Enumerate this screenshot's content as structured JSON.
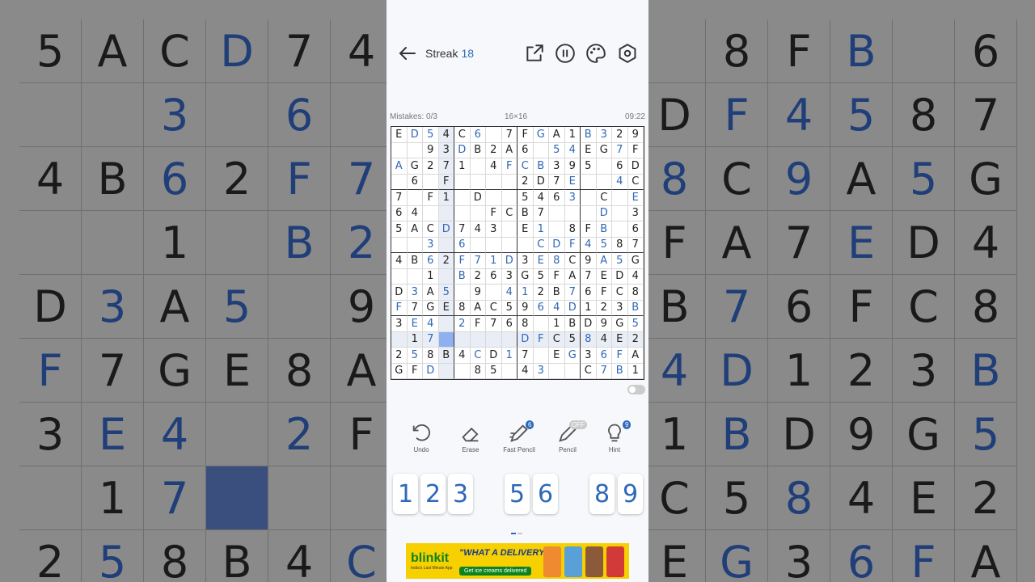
{
  "topbar": {
    "streak_label": "Streak",
    "streak_value": "18"
  },
  "info": {
    "mistakes": "Mistakes: 0/3",
    "size": "16×16",
    "time": "09:22"
  },
  "board": {
    "rows": [
      [
        "E",
        "D",
        "5",
        "4",
        "C",
        "6",
        "",
        "7",
        "F",
        "G",
        "A",
        "1",
        "B",
        "3",
        "2",
        "9"
      ],
      [
        "",
        "",
        "9",
        "3",
        "D",
        "B",
        "2",
        "A",
        "6",
        "",
        "5",
        "4",
        "E",
        "G",
        "7",
        "F"
      ],
      [
        "A",
        "G",
        "2",
        "7",
        "1",
        "",
        "4",
        "F",
        "C",
        "B",
        "3",
        "9",
        "5",
        "",
        "6",
        "D"
      ],
      [
        "",
        "6",
        "",
        "F",
        "",
        "",
        "",
        "",
        "2",
        "D",
        "7",
        "E",
        "",
        "",
        "4",
        "C"
      ],
      [
        "7",
        "",
        "F",
        "1",
        "",
        "D",
        "",
        "",
        "5",
        "4",
        "6",
        "3",
        "",
        "C",
        "",
        "E"
      ],
      [
        "6",
        "4",
        "",
        "",
        "",
        "",
        "F",
        "C",
        "B",
        "7",
        "",
        "",
        "",
        "D",
        "",
        "3"
      ],
      [
        "5",
        "A",
        "C",
        "D",
        "7",
        "4",
        "3",
        "",
        "E",
        "1",
        "",
        "8",
        "F",
        "B",
        "",
        "6"
      ],
      [
        "",
        "",
        "3",
        "",
        "6",
        "",
        "",
        "",
        "",
        "C",
        "D",
        "F",
        "4",
        "5",
        "8",
        "7"
      ],
      [
        "4",
        "B",
        "6",
        "2",
        "F",
        "7",
        "1",
        "D",
        "3",
        "E",
        "8",
        "C",
        "9",
        "A",
        "5",
        "G"
      ],
      [
        "",
        "",
        "1",
        "",
        "B",
        "2",
        "6",
        "3",
        "G",
        "5",
        "F",
        "A",
        "7",
        "E",
        "D",
        "4"
      ],
      [
        "D",
        "3",
        "A",
        "5",
        "",
        "9",
        "",
        "4",
        "1",
        "2",
        "B",
        "7",
        "6",
        "F",
        "C",
        "8"
      ],
      [
        "F",
        "7",
        "G",
        "E",
        "8",
        "A",
        "C",
        "5",
        "9",
        "6",
        "4",
        "D",
        "1",
        "2",
        "3",
        "B"
      ],
      [
        "3",
        "E",
        "4",
        "",
        "2",
        "F",
        "7",
        "6",
        "8",
        "",
        "1",
        "B",
        "D",
        "9",
        "G",
        "5"
      ],
      [
        "",
        "1",
        "7",
        "",
        "",
        "",
        "",
        "",
        "D",
        "F",
        "C",
        "5",
        "8",
        "4",
        "E",
        "2"
      ],
      [
        "2",
        "5",
        "8",
        "B",
        "4",
        "C",
        "D",
        "1",
        "7",
        "",
        "E",
        "G",
        "3",
        "6",
        "F",
        "A"
      ],
      [
        "G",
        "F",
        "D",
        "",
        "",
        "8",
        "5",
        "",
        "4",
        "3",
        "",
        "",
        "C",
        "7",
        "B",
        "1"
      ]
    ],
    "blue": [
      [
        1,
        2,
        5,
        9,
        12,
        13
      ],
      [
        4,
        10,
        11,
        14
      ],
      [
        0,
        7,
        8,
        9
      ],
      [
        11,
        14
      ],
      [
        11,
        15
      ],
      [
        13
      ],
      [
        3,
        7,
        9,
        13
      ],
      [
        2,
        4,
        9,
        10,
        11,
        12,
        13
      ],
      [
        2,
        4,
        5,
        6,
        7,
        9,
        10,
        13,
        14
      ],
      [
        4
      ],
      [
        1,
        3,
        7,
        8,
        11
      ],
      [
        0,
        9,
        10,
        11,
        15
      ],
      [
        1,
        2,
        4,
        15
      ],
      [
        2,
        8,
        9,
        12
      ],
      [
        1,
        5,
        7,
        11,
        13,
        14
      ],
      [
        2,
        9,
        13,
        14
      ]
    ],
    "selected": [
      13,
      3
    ]
  },
  "tools": {
    "undo": "Undo",
    "erase": "Erase",
    "fast_pencil": "Fast Pencil",
    "fast_pencil_badge": "6",
    "pencil": "Pencil",
    "pencil_badge": "OFF",
    "hint": "Hint",
    "hint_badge": "9"
  },
  "numpad": [
    {
      "digit": "1"
    },
    {
      "digit": "2"
    },
    {
      "digit": "3"
    },
    {
      "digit": "5"
    },
    {
      "digit": "6"
    },
    {
      "digit": "8"
    },
    {
      "digit": "9"
    }
  ],
  "ad": {
    "brand": "blinkit",
    "tagline": "India's Last Minute App",
    "headline": "\"WHAT A DELIVERY!\"",
    "cta": "Get ice creams delivered"
  },
  "background": {
    "left_cells": [
      [
        "5",
        "A",
        "C",
        "D",
        "7",
        "4"
      ],
      [
        "",
        "",
        "3",
        "",
        "6",
        ""
      ],
      [
        "4",
        "B",
        "6",
        "2",
        "F",
        "7"
      ],
      [
        "",
        "",
        "1",
        "",
        "B",
        "2"
      ],
      [
        "D",
        "3",
        "A",
        "5",
        "",
        "9"
      ],
      [
        "F",
        "7",
        "G",
        "E",
        "8",
        "A"
      ],
      [
        "3",
        "E",
        "4",
        "",
        "2",
        "F"
      ],
      [
        "",
        "1",
        "7",
        "",
        "",
        ""
      ],
      [
        "2",
        "5",
        "8",
        "B",
        "4",
        "C"
      ]
    ],
    "right_cells": [
      [
        "",
        "8",
        "F",
        "B",
        "",
        "6"
      ],
      [
        "D",
        "F",
        "4",
        "5",
        "8",
        "7"
      ],
      [
        "8",
        "C",
        "9",
        "A",
        "5",
        "G"
      ],
      [
        "F",
        "A",
        "7",
        "E",
        "D",
        "4"
      ],
      [
        "B",
        "7",
        "6",
        "F",
        "C",
        "8"
      ],
      [
        "4",
        "D",
        "1",
        "2",
        "3",
        "B"
      ],
      [
        "1",
        "B",
        "D",
        "9",
        "G",
        "5"
      ],
      [
        "C",
        "5",
        "8",
        "4",
        "E",
        "2"
      ],
      [
        "E",
        "G",
        "3",
        "6",
        "F",
        "A"
      ]
    ]
  }
}
